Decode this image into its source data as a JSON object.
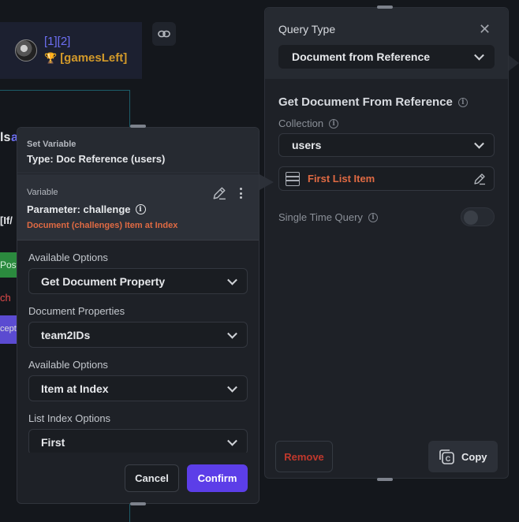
{
  "background": {
    "ref_text": "[1][2]",
    "games_text": "[gamesLeft]",
    "frag_ls": "ls",
    "frag_ls_accent": "a",
    "frag_iff": "[If/",
    "frag_post": "Post",
    "frag_ch": "ch",
    "frag_accept": "cept"
  },
  "query_panel": {
    "title": "Query Type",
    "query_type_value": "Document from Reference",
    "section_title": "Get Document From Reference",
    "collection_label": "Collection",
    "collection_value": "users",
    "reference_value": "First List Item",
    "single_time_query_label": "Single Time Query",
    "single_time_query_enabled": false,
    "remove_label": "Remove",
    "copy_label": "Copy"
  },
  "set_variable": {
    "header_label": "Set Variable",
    "type_label": "Type: Doc Reference (users)",
    "variable_label": "Variable",
    "parameter_label": "Parameter: challenge",
    "source_label": "Document (challenges) Item at Index",
    "fields": [
      {
        "label": "Available Options",
        "value": "Get Document Property"
      },
      {
        "label": "Document Properties",
        "value": "team2IDs"
      },
      {
        "label": "Available Options",
        "value": "Item at Index"
      },
      {
        "label": "List Index Options",
        "value": "First"
      }
    ],
    "cancel_label": "Cancel",
    "confirm_label": "Confirm"
  },
  "colors": {
    "accent_purple": "#5c3ee8",
    "orange": "#e06a43",
    "danger": "#c0382c",
    "link_blue": "#6d6ff2",
    "gold": "#d39a2a"
  }
}
